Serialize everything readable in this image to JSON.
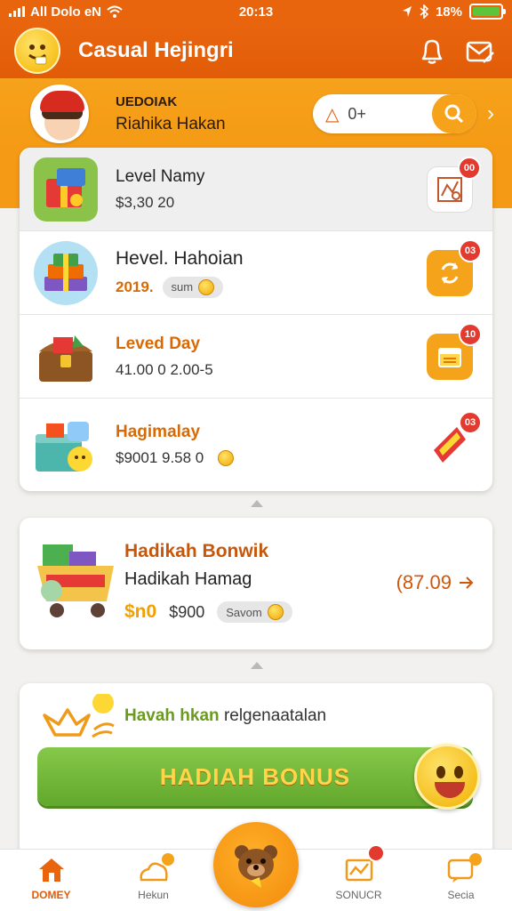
{
  "status_bar": {
    "carrier": "All Dolo eN",
    "time": "20:13",
    "battery": "18%"
  },
  "header": {
    "title": "Casual Hejingri"
  },
  "profile": {
    "name": "UEDOIAK",
    "subtitle": "Riahika Hakan",
    "search_value": "0+"
  },
  "list": {
    "rows": [
      {
        "title": "Level Namy",
        "detail": "$3,30 20",
        "badge": "00"
      },
      {
        "title": "Hevel. Hahoian",
        "detail": "2019.",
        "chip": "sum",
        "badge": "03"
      },
      {
        "title": "Leved Day",
        "detail": "41.00 0 2.00-5",
        "badge": "10"
      },
      {
        "title": "Hagimalay",
        "detail": "$9001 9.58 0",
        "badge": "03"
      }
    ]
  },
  "promo": {
    "title": "Hadikah Bonwik",
    "subtitle": "Hadikah Hamag",
    "highlight": "$n0",
    "amount": "$900",
    "chip": "Savom",
    "price": "(87.09"
  },
  "bonus": {
    "text_green": "Havah hkan",
    "text_rest": "relgenaatalan",
    "button_label": "HADIAH BONUS"
  },
  "nav": {
    "items": [
      {
        "label": "DOMEY"
      },
      {
        "label": "Hekun"
      },
      {
        "label": "SONUCR"
      },
      {
        "label": "Secia"
      }
    ]
  },
  "colors": {
    "primary_orange": "#e8650e",
    "secondary_orange": "#f59a14",
    "bonus_green": "#6aae30",
    "badge_red": "#e23a2e"
  }
}
